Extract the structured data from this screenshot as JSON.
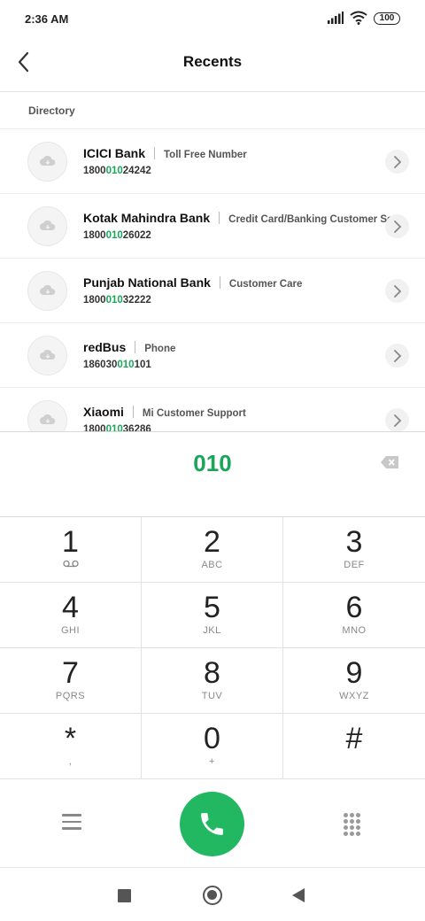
{
  "status_bar": {
    "time": "2:36 AM",
    "battery": "100"
  },
  "header": {
    "title": "Recents"
  },
  "directory": {
    "label": "Directory",
    "items": [
      {
        "name": "ICICI Bank",
        "description": "Toll Free Number",
        "number_pre": "1800",
        "number_match": "010",
        "number_post": "24242"
      },
      {
        "name": "Kotak Mahindra Bank",
        "description": "Credit Card/Banking Customer Ser…",
        "number_pre": "1800",
        "number_match": "010",
        "number_post": "26022"
      },
      {
        "name": "Punjab National Bank",
        "description": "Customer Care",
        "number_pre": "1800",
        "number_match": "010",
        "number_post": "32222"
      },
      {
        "name": "redBus",
        "description": "Phone",
        "number_pre": "186030",
        "number_match": "010",
        "number_post": "101"
      },
      {
        "name": "Xiaomi",
        "description": "Mi Customer Support",
        "number_pre": "1800",
        "number_match": "010",
        "number_post": "36286"
      }
    ]
  },
  "dialer": {
    "input": "010"
  },
  "keypad": [
    {
      "digit": "1",
      "letters": ""
    },
    {
      "digit": "2",
      "letters": "ABC"
    },
    {
      "digit": "3",
      "letters": "DEF"
    },
    {
      "digit": "4",
      "letters": "GHI"
    },
    {
      "digit": "5",
      "letters": "JKL"
    },
    {
      "digit": "6",
      "letters": "MNO"
    },
    {
      "digit": "7",
      "letters": "PQRS"
    },
    {
      "digit": "8",
      "letters": "TUV"
    },
    {
      "digit": "9",
      "letters": "WXYZ"
    },
    {
      "digit": "*",
      "letters": ","
    },
    {
      "digit": "0",
      "letters": "+"
    },
    {
      "digit": "#",
      "letters": ""
    }
  ],
  "icons": {
    "back": "chevron-left-icon",
    "avatar": "cloud-icon",
    "row_action": "chevron-right-icon",
    "delete": "backspace-icon",
    "voicemail": "voicemail-icon",
    "menu": "menu-icon",
    "call": "phone-icon",
    "dialpad": "dialpad-icon"
  },
  "colors": {
    "accent": "#1aa55a",
    "call_button": "#22b861"
  }
}
